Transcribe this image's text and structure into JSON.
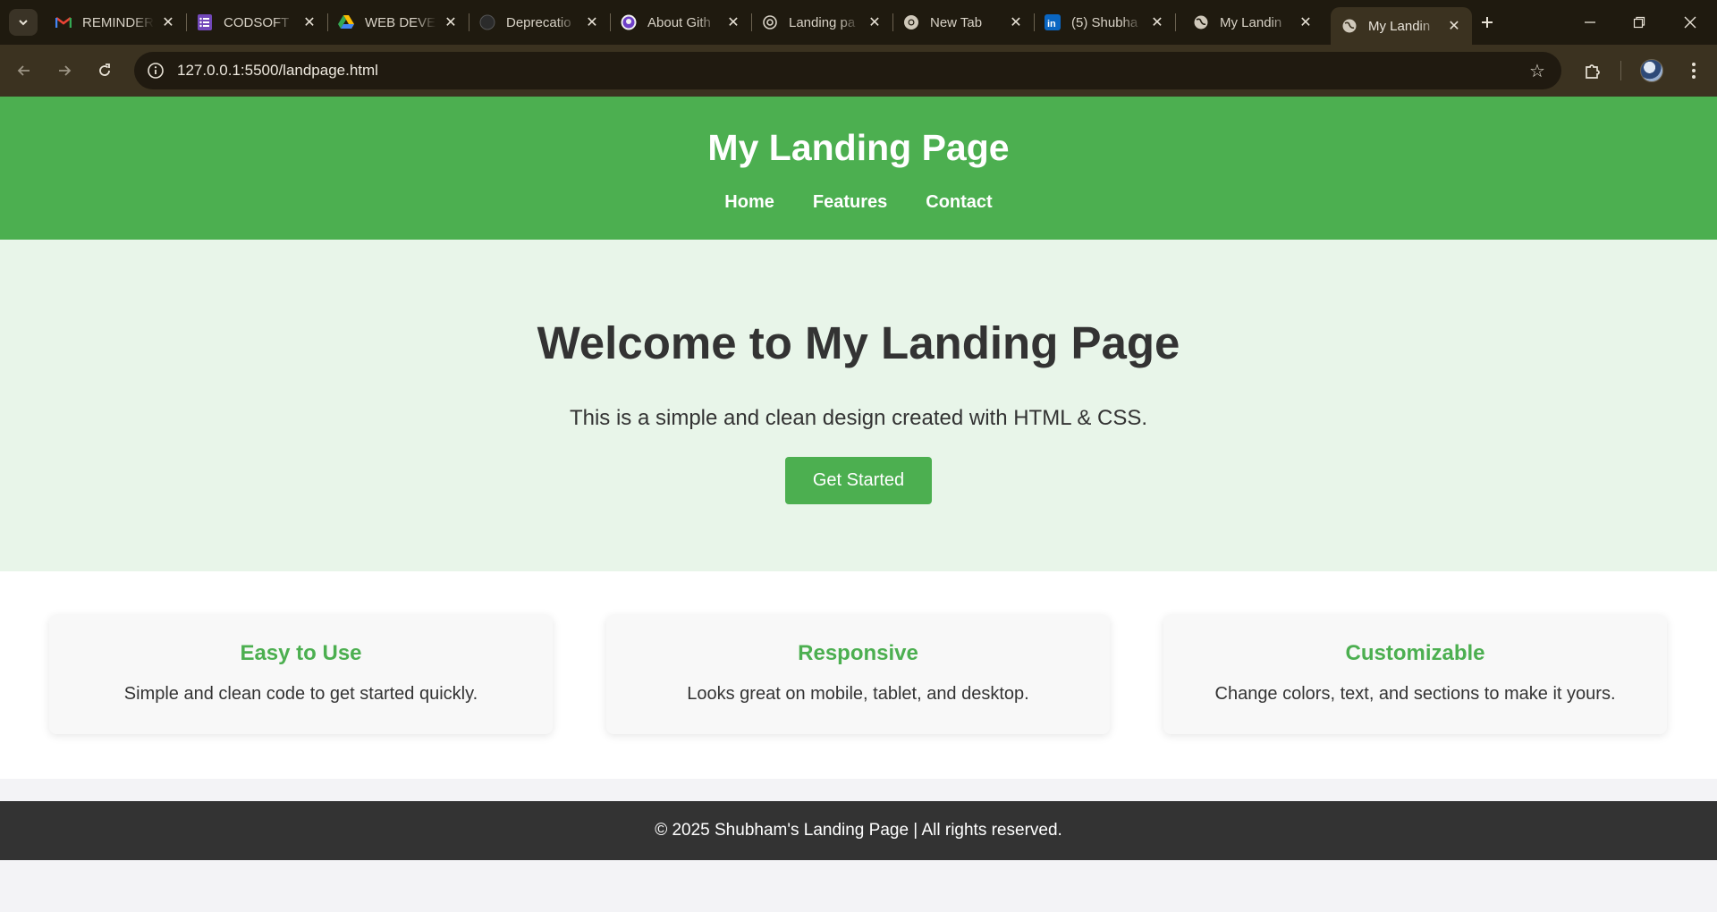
{
  "browser": {
    "tabs": [
      {
        "title": "REMINDER",
        "icon": "gmail-icon",
        "active": false
      },
      {
        "title": "CODSOFT",
        "icon": "forms-icon",
        "active": false
      },
      {
        "title": "WEB DEVE",
        "icon": "drive-icon",
        "active": false
      },
      {
        "title": "Deprecatio",
        "icon": "github-dark-icon",
        "active": false
      },
      {
        "title": "About Gith",
        "icon": "github-icon",
        "active": false
      },
      {
        "title": "Landing pa",
        "icon": "openai-icon",
        "active": false
      },
      {
        "title": "New Tab",
        "icon": "chrome-icon",
        "active": false
      },
      {
        "title": "(5) Shubha",
        "icon": "linkedin-icon",
        "active": false
      },
      {
        "title": "My Landin",
        "icon": "globe-icon",
        "active": false
      },
      {
        "title": "My Landin",
        "icon": "globe-icon",
        "active": true
      }
    ],
    "url": "127.0.0.1:5500/landpage.html"
  },
  "header": {
    "title": "My Landing Page",
    "nav": [
      "Home",
      "Features",
      "Contact"
    ]
  },
  "hero": {
    "heading": "Welcome to My Landing Page",
    "subtitle": "This is a simple and clean design created with HTML & CSS.",
    "cta_label": "Get Started"
  },
  "features": [
    {
      "title": "Easy to Use",
      "text": "Simple and clean code to get started quickly."
    },
    {
      "title": "Responsive",
      "text": "Looks great on mobile, tablet, and desktop."
    },
    {
      "title": "Customizable",
      "text": "Change colors, text, and sections to make it yours."
    }
  ],
  "footer": {
    "text": "© 2025 Shubham's Landing Page | All rights reserved."
  },
  "colors": {
    "accent": "#4caf50",
    "hero_bg": "#e8f5e9",
    "footer_bg": "#333333",
    "chrome_bg": "#3b3220"
  }
}
